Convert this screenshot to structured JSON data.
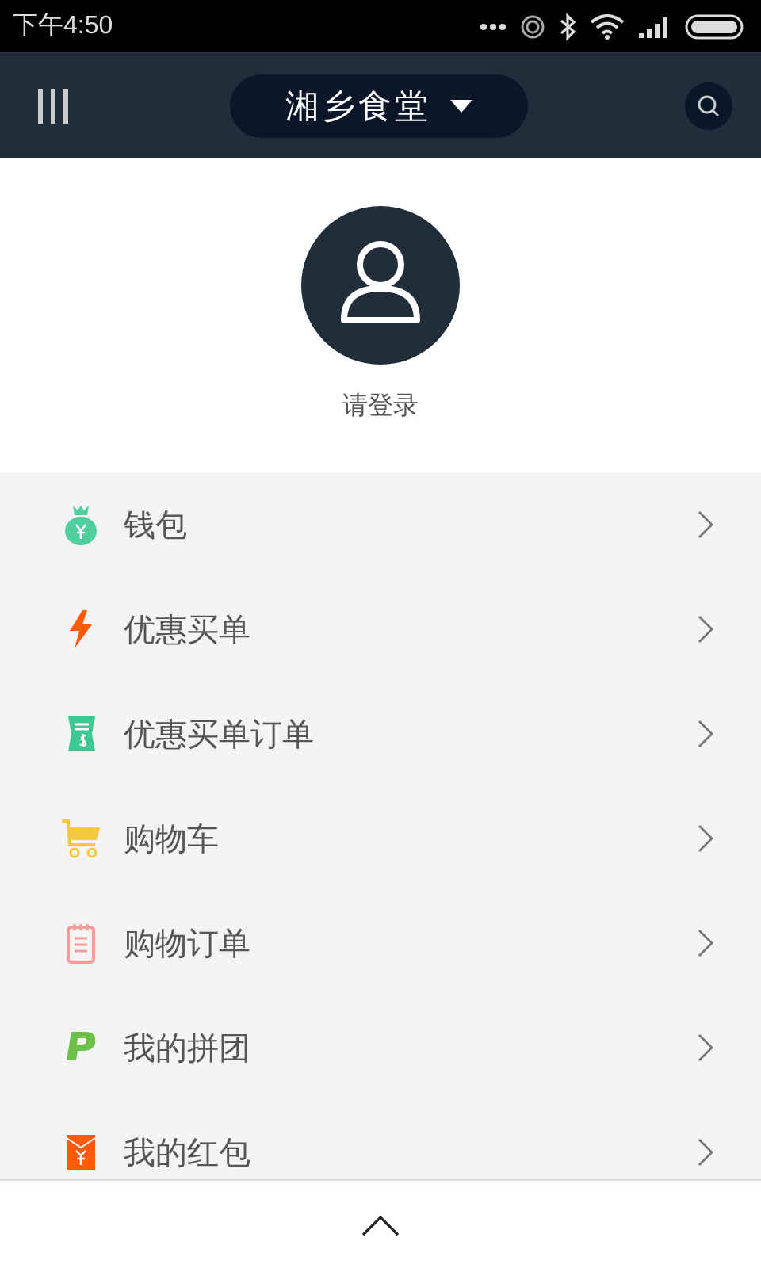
{
  "status_bar": {
    "time": "下午4:50"
  },
  "header": {
    "store_name": "湘乡食堂"
  },
  "profile": {
    "login_prompt": "请登录"
  },
  "menu": [
    {
      "kind": "money-bag",
      "label": "钱包"
    },
    {
      "kind": "bolt",
      "label": "优惠买单"
    },
    {
      "kind": "receipt",
      "label": "优惠买单订单"
    },
    {
      "kind": "cart",
      "label": "购物车"
    },
    {
      "kind": "notepad",
      "label": "购物订单"
    },
    {
      "kind": "p-badge",
      "label": "我的拼团"
    },
    {
      "kind": "envelope",
      "label": "我的红包"
    }
  ]
}
